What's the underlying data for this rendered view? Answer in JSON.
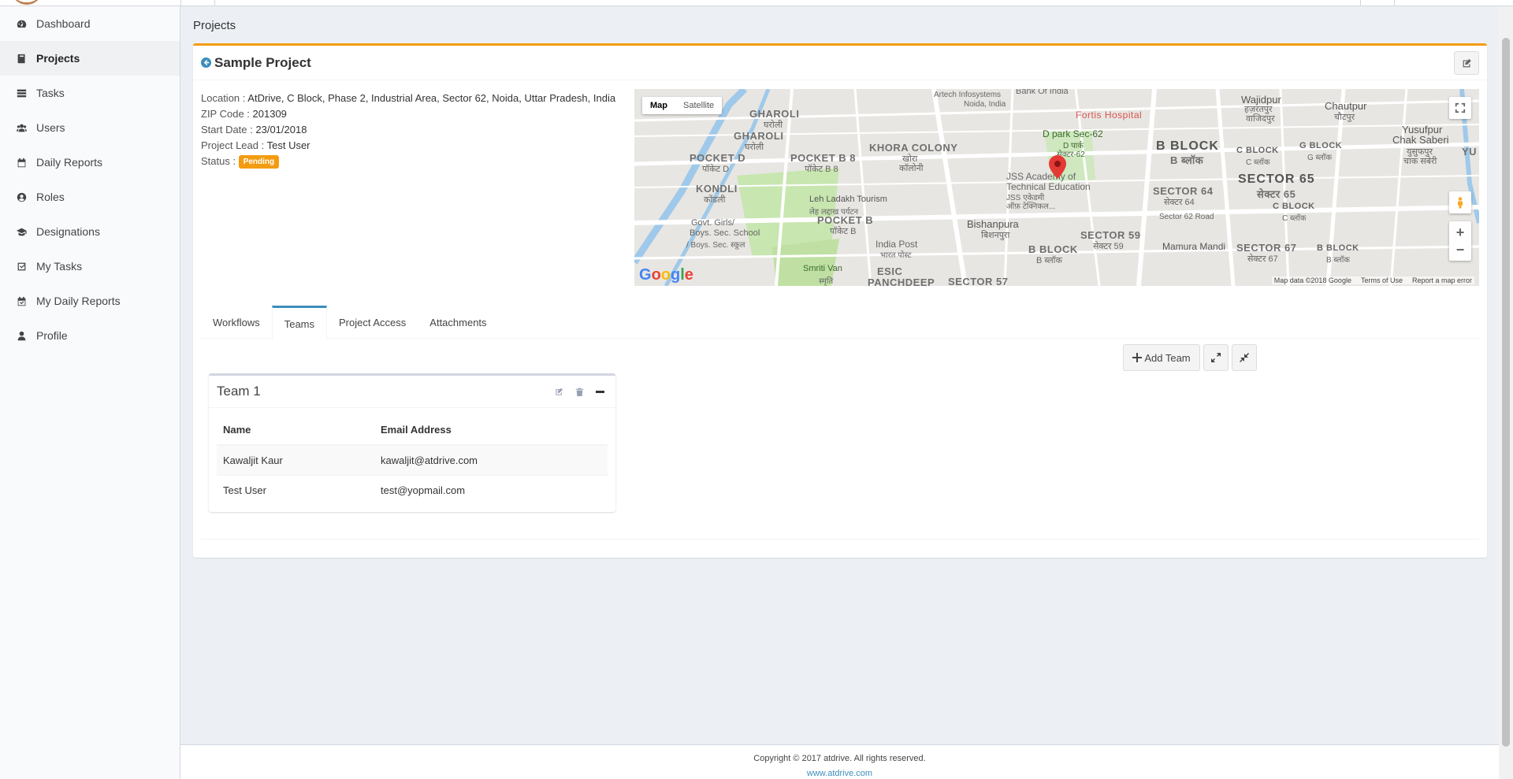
{
  "sidebar": {
    "items": [
      {
        "label": "Dashboard",
        "icon": "dashboard-icon"
      },
      {
        "label": "Projects",
        "icon": "book-icon"
      },
      {
        "label": "Tasks",
        "icon": "tasks-icon"
      },
      {
        "label": "Users",
        "icon": "users-icon"
      },
      {
        "label": "Daily Reports",
        "icon": "calendar-icon"
      },
      {
        "label": "Roles",
        "icon": "user-circle-icon"
      },
      {
        "label": "Designations",
        "icon": "graduation-cap-icon"
      },
      {
        "label": "My Tasks",
        "icon": "check-square-icon"
      },
      {
        "label": "My Daily Reports",
        "icon": "calendar-check-icon"
      },
      {
        "label": "Profile",
        "icon": "user-icon"
      }
    ],
    "active": "Projects"
  },
  "page": {
    "breadcrumb": "Projects",
    "title": "Sample Project"
  },
  "project": {
    "location_label": "Location :",
    "location": "AtDrive, C Block, Phase 2, Industrial Area, Sector 62, Noida, Uttar Pradesh, India",
    "zip_label": "ZIP Code :",
    "zip": "201309",
    "start_label": "Start Date :",
    "start": "23/01/2018",
    "lead_label": "Project Lead :",
    "lead": "Test User",
    "status_label": "Status :",
    "status": "Pending",
    "status_color": "#f39c12"
  },
  "map": {
    "type_map": "Map",
    "type_satellite": "Satellite",
    "labels": {
      "gharoli1": "GHAROLI",
      "gharoli1_hi": "घरोली",
      "gharoli2": "GHAROLI",
      "gharoli2_hi": "घरोली",
      "pocket_d": "POCKET D",
      "pocket_d_hi": "पॉकेट D",
      "pocket_b8": "POCKET B 8",
      "pocket_b8_hi": "पॉकेट B 8",
      "khora": "KHORA COLONY",
      "khora_hi": "खोरा",
      "khora_hi2": "कॉलोनी",
      "kondli": "KONDLI",
      "kondli_hi": "कोंडली",
      "leh": "Leh Ladakh Tourism",
      "leh_hi": "लेह लद्दाख पर्यटन",
      "pocket_b": "POCKET B",
      "pocket_b_hi": "पॉकेट B",
      "govt": "Govt. Girls/",
      "govt2": "Boys. Sec. School",
      "govt3": "/ Boys. Sec. स्कूल",
      "smriti": "Smriti Van",
      "smriti_hi": "स्मृति",
      "esic": "ESIC",
      "panchdeep": "PANCHDEEP",
      "sector57": "SECTOR 57",
      "artech": "Artech Infosystems",
      "artech2": "Noida, India",
      "bank": "Bank Of India",
      "fortis": "Fortis Hospital",
      "dpark": "D park Sec-62",
      "dpark_hi": "D पार्क",
      "dpark_hi2": "सेक्टर-62",
      "jss": "JSS Academy of",
      "jss2": "Technical Education",
      "jss3": "JSS एकेडमी",
      "jss4": "ऑफ़ टेक्निकल...",
      "bishanpura": "Bishanpura",
      "bishanpura_hi": "बिशनपुरा",
      "india_post": "India Post",
      "india_post_hi": "भारत पोस्ट",
      "bblock": "B BLOCK",
      "bblock_hi": "B ब्लॉक",
      "bblock_big": "B BLOCK",
      "bblock_big_hi": "B ब्लॉक",
      "sector59": "SECTOR 59",
      "sector59_hi": "सेक्टर 59",
      "sector64": "SECTOR 64",
      "sector64_hi": "सेक्टर 64",
      "sector62road": "Sector 62 Road",
      "mamura": "Mamura Mandi",
      "sector65": "SECTOR 65",
      "sector65_hi": "सेक्टर 65",
      "sector67": "SECTOR 67",
      "sector67_hi": "सेक्टर 67",
      "cblock1": "C BLOCK",
      "cblock1_hi": "C ब्लॉक",
      "gblock": "G BLOCK",
      "gblock_hi": "G ब्लॉक",
      "cblock2": "C BLOCK",
      "cblock2_hi": "C ब्लॉक",
      "bblock3": "B BLOCK",
      "bblock3_hi": "B ब्लॉक",
      "wajidpur": "Wajidpur",
      "wajidpur_hi": "वाजिदपुर",
      "wajidpur_hi2": "हज़रतपुर",
      "chautpur": "Chautpur",
      "chautpur_hi": "चौटपुर",
      "yusufpur": "Yusufpur",
      "yusufpur2": "Chak Saberi",
      "yusufpur_hi": "युसुफपुर",
      "yusufpur_hi2": "चाक सबेरी",
      "yu": "YU"
    },
    "footer_data": "Map data ©2018 Google",
    "footer_terms": "Terms of Use",
    "footer_report": "Report a map error",
    "google": "Google"
  },
  "tabs": [
    {
      "label": "Workflows",
      "active": false
    },
    {
      "label": "Teams",
      "active": true
    },
    {
      "label": "Project Access",
      "active": false
    },
    {
      "label": "Attachments",
      "active": false
    }
  ],
  "teams": {
    "add_label": "Add Team",
    "team": {
      "title": "Team 1",
      "columns": [
        "Name",
        "Email Address"
      ],
      "rows": [
        {
          "name": "Kawaljit Kaur",
          "email": "kawaljit@atdrive.com"
        },
        {
          "name": "Test User",
          "email": "test@yopmail.com"
        }
      ]
    }
  },
  "footer": {
    "copyright": "Copyright © 2017 atdrive. All rights reserved.",
    "link": "www.atdrive.com"
  }
}
